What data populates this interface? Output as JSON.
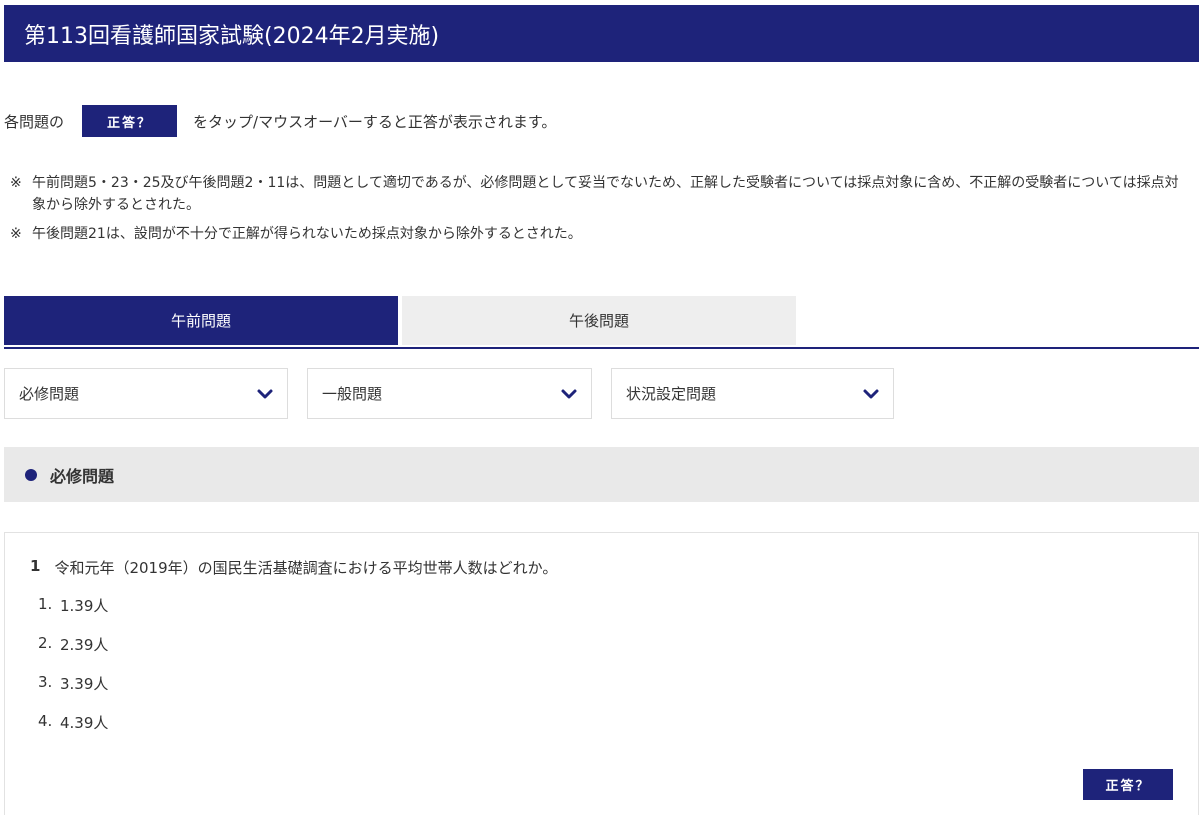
{
  "header": {
    "title": "第113回看護師国家試験(2024年2月実施)"
  },
  "intro": {
    "prefix": "各問題の",
    "answer_button": "正答？",
    "suffix": "をタップ/マウスオーバーすると正答が表示されます。"
  },
  "notes": [
    {
      "mark": "※",
      "text": "午前問題5・23・25及び午後問題2・11は、問題として適切であるが、必修問題として妥当でないため、正解した受験者については採点対象に含め、不正解の受験者については採点対象から除外するとされた。"
    },
    {
      "mark": "※",
      "text": "午後問題21は、設問が不十分で正解が得られないため採点対象から除外するとされた。"
    }
  ],
  "tabs": [
    {
      "label": "午前問題",
      "active": true
    },
    {
      "label": "午後問題",
      "active": false
    }
  ],
  "selects": [
    {
      "label": "必修問題",
      "icon": "chevron-down-icon"
    },
    {
      "label": "一般問題",
      "icon": "chevron-down-icon"
    },
    {
      "label": "状況設定問題",
      "icon": "chevron-down-icon"
    }
  ],
  "section": {
    "title": "必修問題"
  },
  "question": {
    "number": "1",
    "text": "令和元年（2019年）の国民生活基礎調査における平均世帯人数はどれか。",
    "choices": [
      {
        "no": "1.",
        "text": "1.39人"
      },
      {
        "no": "2.",
        "text": "2.39人"
      },
      {
        "no": "3.",
        "text": "3.39人"
      },
      {
        "no": "4.",
        "text": "4.39人"
      }
    ],
    "answer_button": "正答？"
  },
  "colors": {
    "brand": "#1e237a",
    "tab_inactive": "#eeeeee",
    "section_bg": "#e9e9e9"
  }
}
